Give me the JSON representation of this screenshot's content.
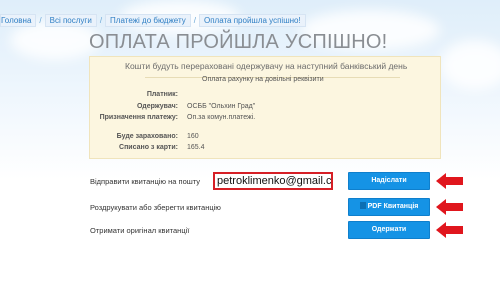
{
  "breadcrumb": {
    "items": [
      {
        "label": "Головна"
      },
      {
        "label": "Всі послуги"
      },
      {
        "label": "Платежі до бюджету"
      },
      {
        "label": "Оплата пройшла успішно!"
      }
    ]
  },
  "page_title": "ОПЛАТА ПРОЙШЛА УСПІШНО!",
  "receipt": {
    "notice": "Кошти будуть перераховані одержувачу на наступний банківський день",
    "subtitle": "Оплата рахунку на довільні реквізити",
    "rows": [
      {
        "label": "Платник:",
        "value": ""
      },
      {
        "label": "Одержувач:",
        "value": "ОСББ \"Ольхин Град\""
      },
      {
        "label": "Призначення платежу:",
        "value": "Оп.за комун.платежі."
      },
      {
        "label": "Буде зараховано:",
        "value": "160"
      },
      {
        "label": "Списано з карти:",
        "value": "165.4"
      }
    ]
  },
  "actions": {
    "send_label": "Відправити квитанцію на пошту",
    "email_value": "petroklimenko@gmail.com",
    "send_button": "Надіслати",
    "print_label": "Роздрукувати або зберегти квитанцію",
    "pdf_button": "PDF Квитанція",
    "original_label": "Отримати оригінал квитанції",
    "original_button": "Одержати"
  },
  "colors": {
    "accent": "#1593e5",
    "highlight": "#d61f26",
    "panel": "#fcf6e0"
  },
  "icons": [
    "pdf-icon",
    "arrow-left-icon"
  ]
}
